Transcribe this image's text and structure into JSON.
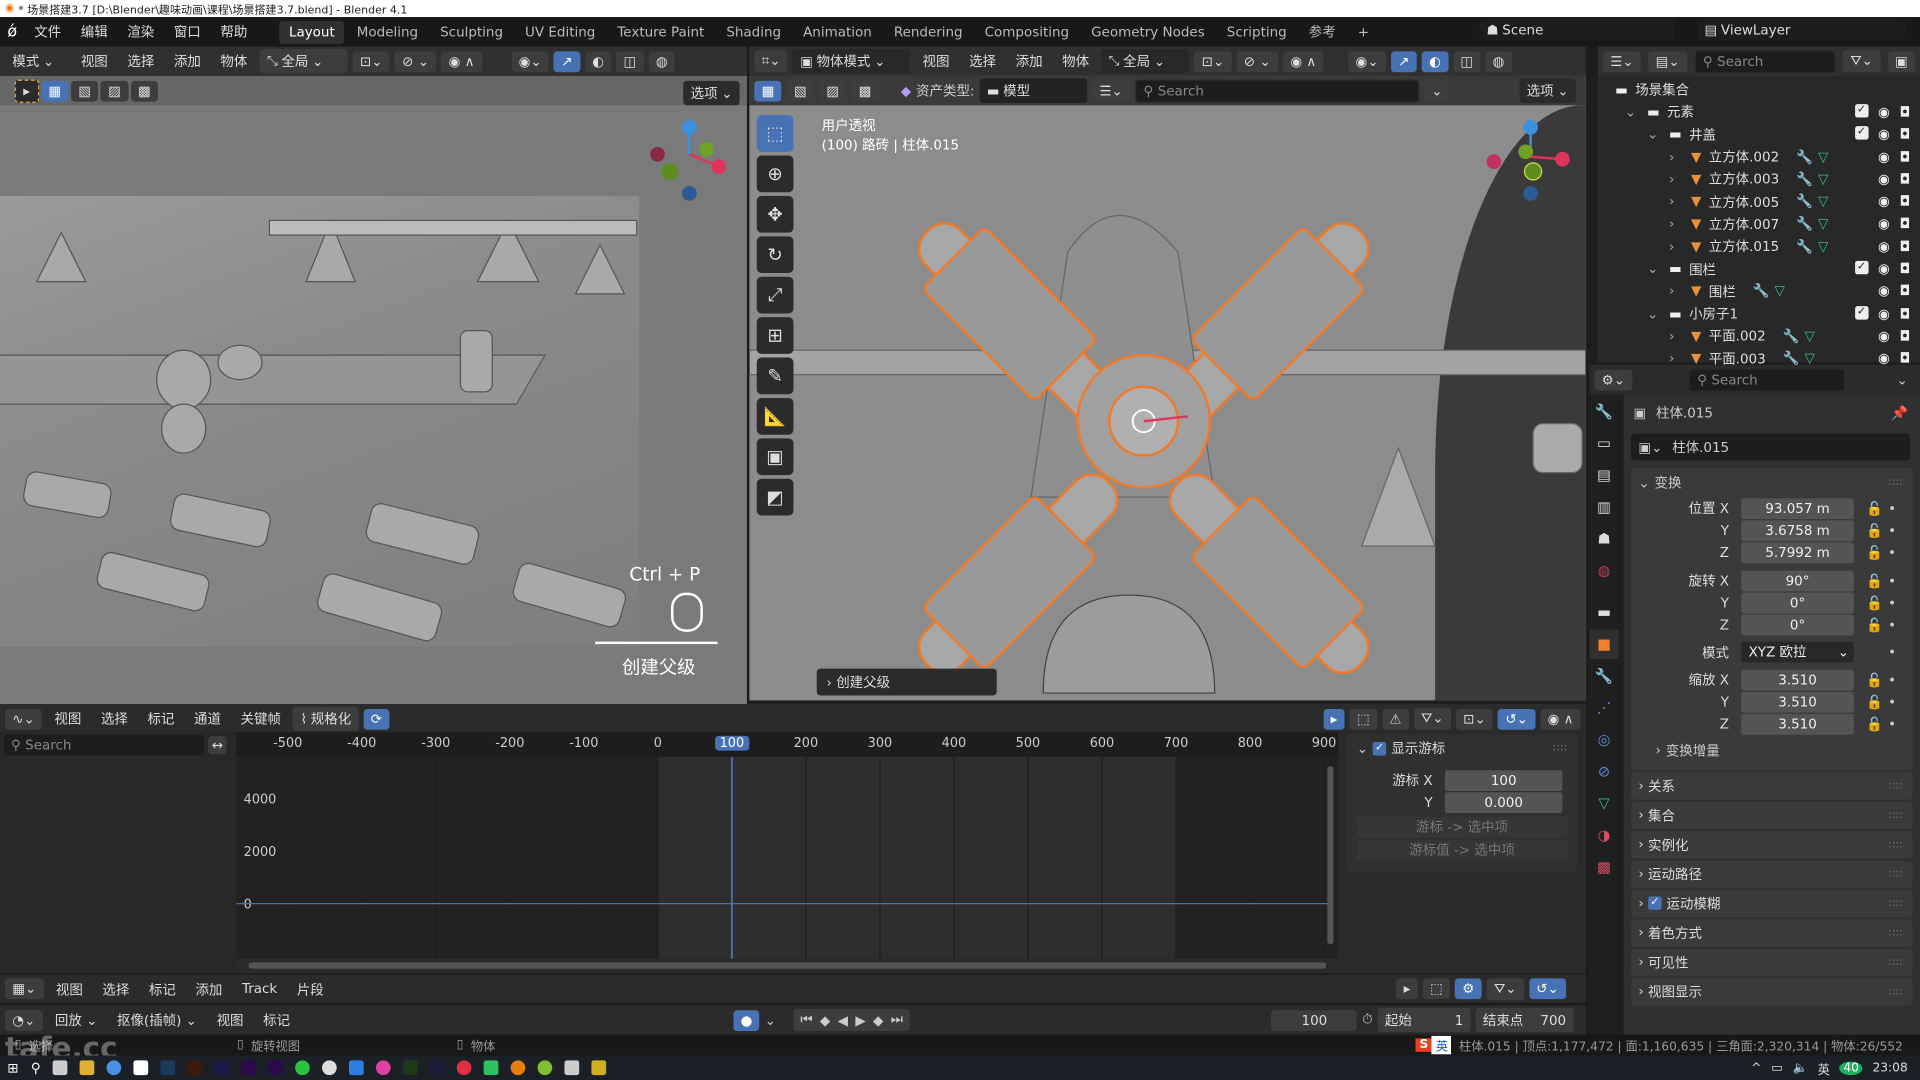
{
  "window": {
    "title": "* 场景搭建3.7 [D:\\Blender\\趣味动画\\课程\\场景搭建3.7.blend] - Blender 4.1"
  },
  "menu": {
    "items": [
      "文件",
      "编辑",
      "渲染",
      "窗口",
      "帮助"
    ]
  },
  "workspaces": {
    "tabs": [
      "Layout",
      "Modeling",
      "Sculpting",
      "UV Editing",
      "Texture Paint",
      "Shading",
      "Animation",
      "Rendering",
      "Compositing",
      "Geometry Nodes",
      "Scripting",
      "参考"
    ],
    "active": "Layout",
    "add": "+"
  },
  "scene": {
    "name": "Scene",
    "view_layer": "ViewLayer"
  },
  "left_viewport": {
    "mode": "模式",
    "menus": [
      "视图",
      "选择",
      "添加",
      "物体"
    ],
    "orientation": "全局",
    "options": "选项",
    "shortcut": "Ctrl + P",
    "operator": "创建父级"
  },
  "right_viewport": {
    "mode": "物体模式",
    "menus": [
      "视图",
      "选择",
      "添加",
      "物体"
    ],
    "orientation": "全局",
    "options": "选项",
    "asset_type_label": "资产类型:",
    "asset_type": "模型",
    "search_placeholder": "Search",
    "view_name": "用户透视",
    "view_info": "(100) 路砖 | 柱体.015",
    "last_op": "创建父级"
  },
  "outliner": {
    "search_placeholder": "Search",
    "root": "场景集合",
    "items": [
      {
        "name": "元素",
        "type": "collection",
        "level": 1
      },
      {
        "name": "井盖",
        "type": "collection",
        "level": 2
      },
      {
        "name": "立方体.002",
        "type": "mesh",
        "level": 3
      },
      {
        "name": "立方体.003",
        "type": "mesh",
        "level": 3
      },
      {
        "name": "立方体.005",
        "type": "mesh",
        "level": 3
      },
      {
        "name": "立方体.007",
        "type": "mesh",
        "level": 3
      },
      {
        "name": "立方体.015",
        "type": "mesh",
        "level": 3
      },
      {
        "name": "围栏",
        "type": "collection",
        "level": 2
      },
      {
        "name": "围栏",
        "type": "mesh",
        "level": 3
      },
      {
        "name": "小房子1",
        "type": "collection",
        "level": 2
      },
      {
        "name": "平面.002",
        "type": "mesh",
        "level": 3
      },
      {
        "name": "平面.003",
        "type": "mesh",
        "level": 3
      }
    ]
  },
  "properties": {
    "search_placeholder": "Search",
    "object_name": "柱体.015",
    "object_field": "柱体.015",
    "transform": {
      "title": "变换",
      "location_label": "位置 X",
      "location": [
        "93.057 m",
        "3.6758 m",
        "5.7992 m"
      ],
      "rotation_label": "旋转 X",
      "rotation": [
        "90°",
        "0°",
        "0°"
      ],
      "mode_label": "模式",
      "mode": "XYZ 欧拉",
      "scale_label": "缩放 X",
      "scale": [
        "3.510",
        "3.510",
        "3.510"
      ],
      "axis_y": "Y",
      "axis_z": "Z",
      "delta": "变换增量"
    },
    "sections": [
      "关系",
      "集合",
      "实例化",
      "运动路径",
      "运动模糊",
      "着色方式",
      "可见性",
      "视图显示"
    ]
  },
  "graph_editor": {
    "menus": [
      "视图",
      "选择",
      "标记",
      "通道",
      "关键帧"
    ],
    "normalize": "规格化",
    "search_placeholder": "Search",
    "x_ticks": [
      "-500",
      "-400",
      "-300",
      "-200",
      "-100",
      "0",
      "100",
      "200",
      "300",
      "400",
      "500",
      "600",
      "700",
      "800",
      "900"
    ],
    "y_ticks": [
      "4000",
      "2000",
      "0"
    ],
    "current_frame": "100",
    "cursor_panel": {
      "title": "显示游标",
      "cursor_x_label": "游标 X",
      "cursor_x": "100",
      "cursor_y_label": "Y",
      "cursor_y": "0.000",
      "btn1": "游标 -> 选中项",
      "btn2": "游标值 -> 选中项"
    }
  },
  "nla": {
    "menus": [
      "视图",
      "选择",
      "标记",
      "添加",
      "Track",
      "片段"
    ]
  },
  "timeline": {
    "menus": [
      "回放",
      "抠像(插帧)",
      "视图",
      "标记"
    ],
    "current_frame": "100",
    "start_label": "起始",
    "start": "1",
    "end_label": "结束点",
    "end": "700"
  },
  "status": {
    "hints": [
      "选择",
      "旋转视图",
      "物体"
    ],
    "ime": "英",
    "stats": "柱体.015 | 顶点:1,177,472 | 面:1,160,635 | 三角面:2,320,314 | 物体:26/552"
  },
  "taskbar": {
    "clock": "23:08",
    "ime": "英",
    "badge": "40"
  },
  "watermark": "tafe.cc",
  "colors": {
    "accent": "#4772b3",
    "selection": "#f07a28",
    "bg": "#303030",
    "viewport": "#7a7a7a"
  }
}
